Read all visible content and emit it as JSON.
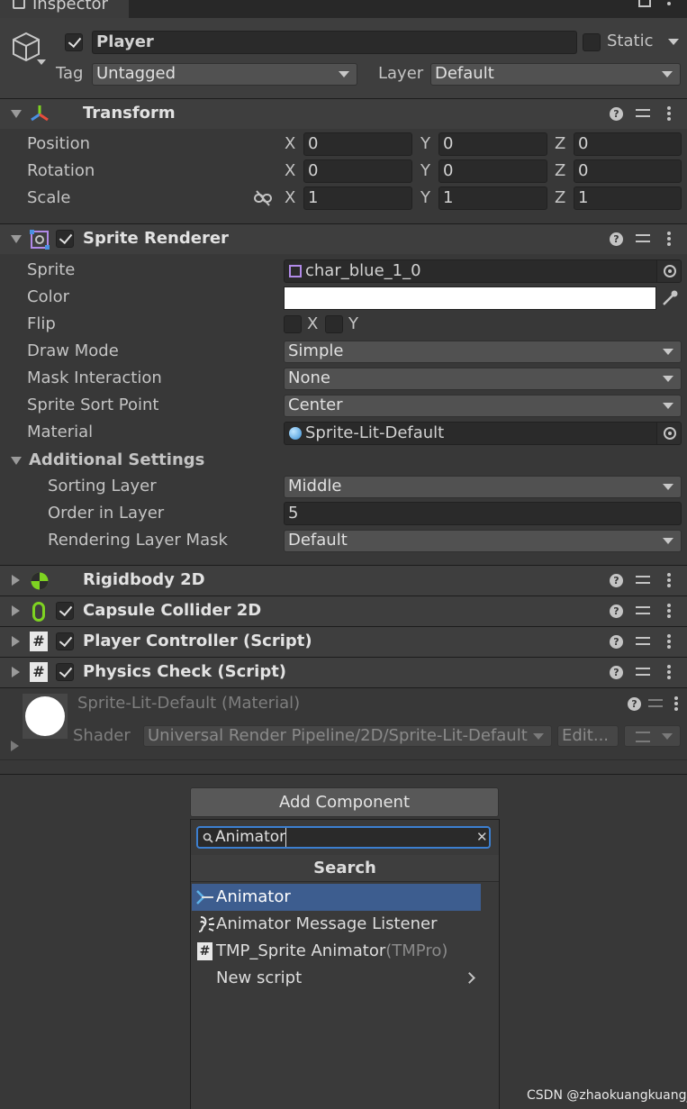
{
  "window": {
    "tab_title": "Inspector"
  },
  "gameobject": {
    "name": "Player",
    "static_label": "Static",
    "tag_label": "Tag",
    "tag_value": "Untagged",
    "layer_label": "Layer",
    "layer_value": "Default"
  },
  "transform": {
    "title": "Transform",
    "rows": [
      {
        "label": "Position",
        "x": "0",
        "y": "0",
        "z": "0"
      },
      {
        "label": "Rotation",
        "x": "0",
        "y": "0",
        "z": "0"
      },
      {
        "label": "Scale",
        "x": "1",
        "y": "1",
        "z": "1"
      }
    ],
    "axis": {
      "x": "X",
      "y": "Y",
      "z": "Z"
    }
  },
  "sprite_renderer": {
    "title": "Sprite Renderer",
    "sprite_label": "Sprite",
    "sprite_value": "char_blue_1_0",
    "color_label": "Color",
    "color_value": "#ffffff",
    "flip_label": "Flip",
    "flip_x": "X",
    "flip_y": "Y",
    "draw_mode_label": "Draw Mode",
    "draw_mode_value": "Simple",
    "mask_label": "Mask Interaction",
    "mask_value": "None",
    "sort_point_label": "Sprite Sort Point",
    "sort_point_value": "Center",
    "material_label": "Material",
    "material_value": "Sprite-Lit-Default",
    "additional_label": "Additional Settings",
    "sorting_layer_label": "Sorting Layer",
    "sorting_layer_value": "Middle",
    "order_label": "Order in Layer",
    "order_value": "5",
    "rlm_label": "Rendering Layer Mask",
    "rlm_value": "Default"
  },
  "components": [
    {
      "title": "Rigidbody 2D",
      "icon": "rigidbody-icon"
    },
    {
      "title": "Capsule Collider 2D",
      "icon": "capsule-icon"
    },
    {
      "title": "Player Controller (Script)",
      "icon": "script-icon"
    },
    {
      "title": "Physics Check (Script)",
      "icon": "script-icon"
    }
  ],
  "material_block": {
    "title": "Sprite-Lit-Default (Material)",
    "shader_label": "Shader",
    "shader_value": "Universal Render Pipeline/2D/Sprite-Lit-Default",
    "edit_label": "Edit..."
  },
  "add_component": {
    "button_label": "Add Component",
    "search_value": "Animator",
    "section_title": "Search",
    "results": [
      {
        "label": "Animator",
        "suffix": "",
        "icon": "animator-icon"
      },
      {
        "label": "Animator Message Listener",
        "suffix": "",
        "icon": "listener-icon"
      },
      {
        "label": "TMP_Sprite Animator",
        "suffix": "(TMPro)",
        "icon": "script-icon"
      },
      {
        "label": "New script",
        "suffix": "",
        "icon": ""
      }
    ]
  },
  "watermark": "CSDN @zhaokuangkuang_"
}
